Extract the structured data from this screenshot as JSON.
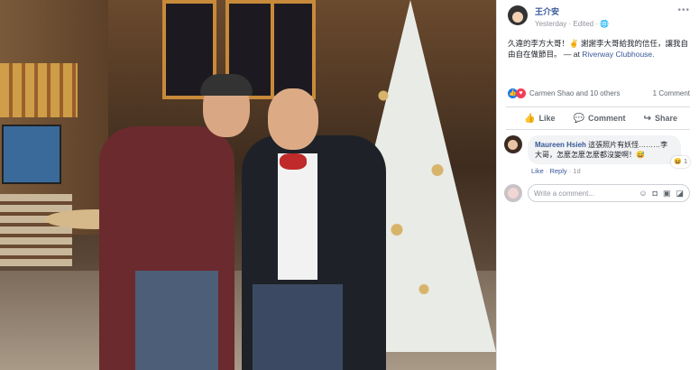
{
  "post": {
    "author": "王介安",
    "time": "Yesterday",
    "edited": "Edited",
    "privacy_icon": "globe-icon",
    "more_icon": "more-icon",
    "text": "久違的李方大哥！✌️ 謝謝李大哥給我的信任，讓我自由自在做節目。",
    "location_prefix": " — at ",
    "location": "Riverway Clubhouse."
  },
  "reactions": {
    "summary": "Carmen Shao and 10 others",
    "comments": "1 Comment"
  },
  "actions": {
    "like": "Like",
    "comment": "Comment",
    "share": "Share"
  },
  "comment": {
    "name": "Maureen Hsieh",
    "text": "這張照片有妖怪………李大哥，怎麼怎麼怎麼都沒變啊！😅",
    "reaction_count": "1",
    "reaction_emoji": "😆",
    "like": "Like",
    "reply": "Reply",
    "age": "1d"
  },
  "composer": {
    "placeholder": "Write a comment..."
  },
  "colors": {
    "link": "#385898",
    "like_blue": "#1877f2",
    "love_red": "#f33e58"
  }
}
